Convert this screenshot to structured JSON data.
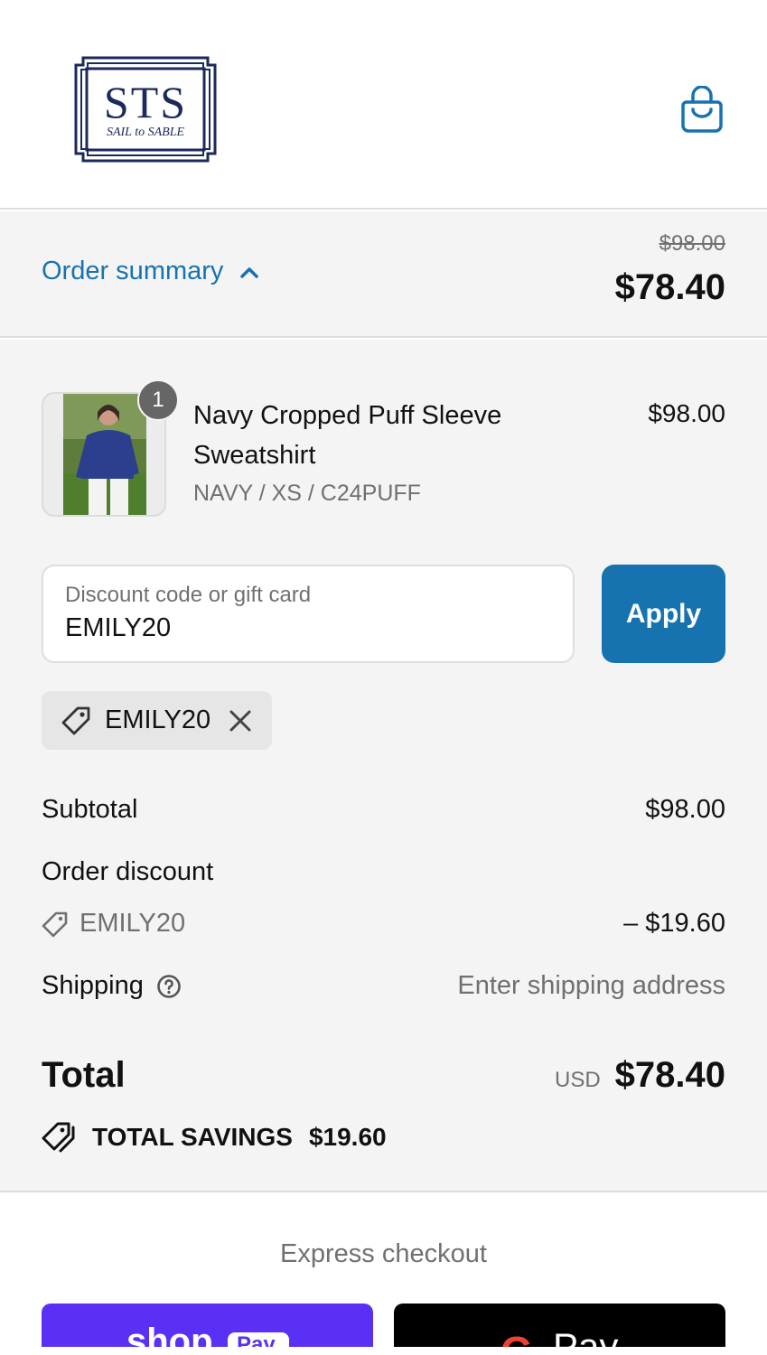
{
  "brand": {
    "logo_initials": "STS",
    "logo_subtitle": "SAIL to SABLE"
  },
  "summary_bar": {
    "toggle_label": "Order summary",
    "original_price": "$98.00",
    "discounted_price": "$78.40"
  },
  "line_item": {
    "quantity": "1",
    "name": "Navy Cropped Puff Sleeve Sweatshirt",
    "variant": "NAVY / XS / C24PUFF",
    "price": "$98.00"
  },
  "discount": {
    "placeholder": "Discount code or gift card",
    "value": "EMILY20",
    "apply_label": "Apply",
    "applied_code": "EMILY20"
  },
  "totals": {
    "subtotal_label": "Subtotal",
    "subtotal_value": "$98.00",
    "order_discount_label": "Order discount",
    "discount_code": "EMILY20",
    "discount_value": "– $19.60",
    "shipping_label": "Shipping",
    "shipping_value": "Enter shipping address",
    "total_label": "Total",
    "currency": "USD",
    "total_value": "$78.40",
    "savings_label": "TOTAL SAVINGS",
    "savings_value": "$19.60"
  },
  "express": {
    "title": "Express checkout",
    "shop_pay_label": "shop",
    "shop_pay_badge": "Pay",
    "gpay_g": "G",
    "gpay_label": "Pay"
  },
  "colors": {
    "accent": "#1773b0",
    "shop_pay": "#5a31f4",
    "brand_navy": "#1b2a5c"
  },
  "icons": {
    "cart": "shopping-bag-icon",
    "toggle": "chevron-up-icon",
    "tag": "tag-icon",
    "remove": "close-icon",
    "help": "question-circle-icon",
    "savings": "tags-icon"
  }
}
